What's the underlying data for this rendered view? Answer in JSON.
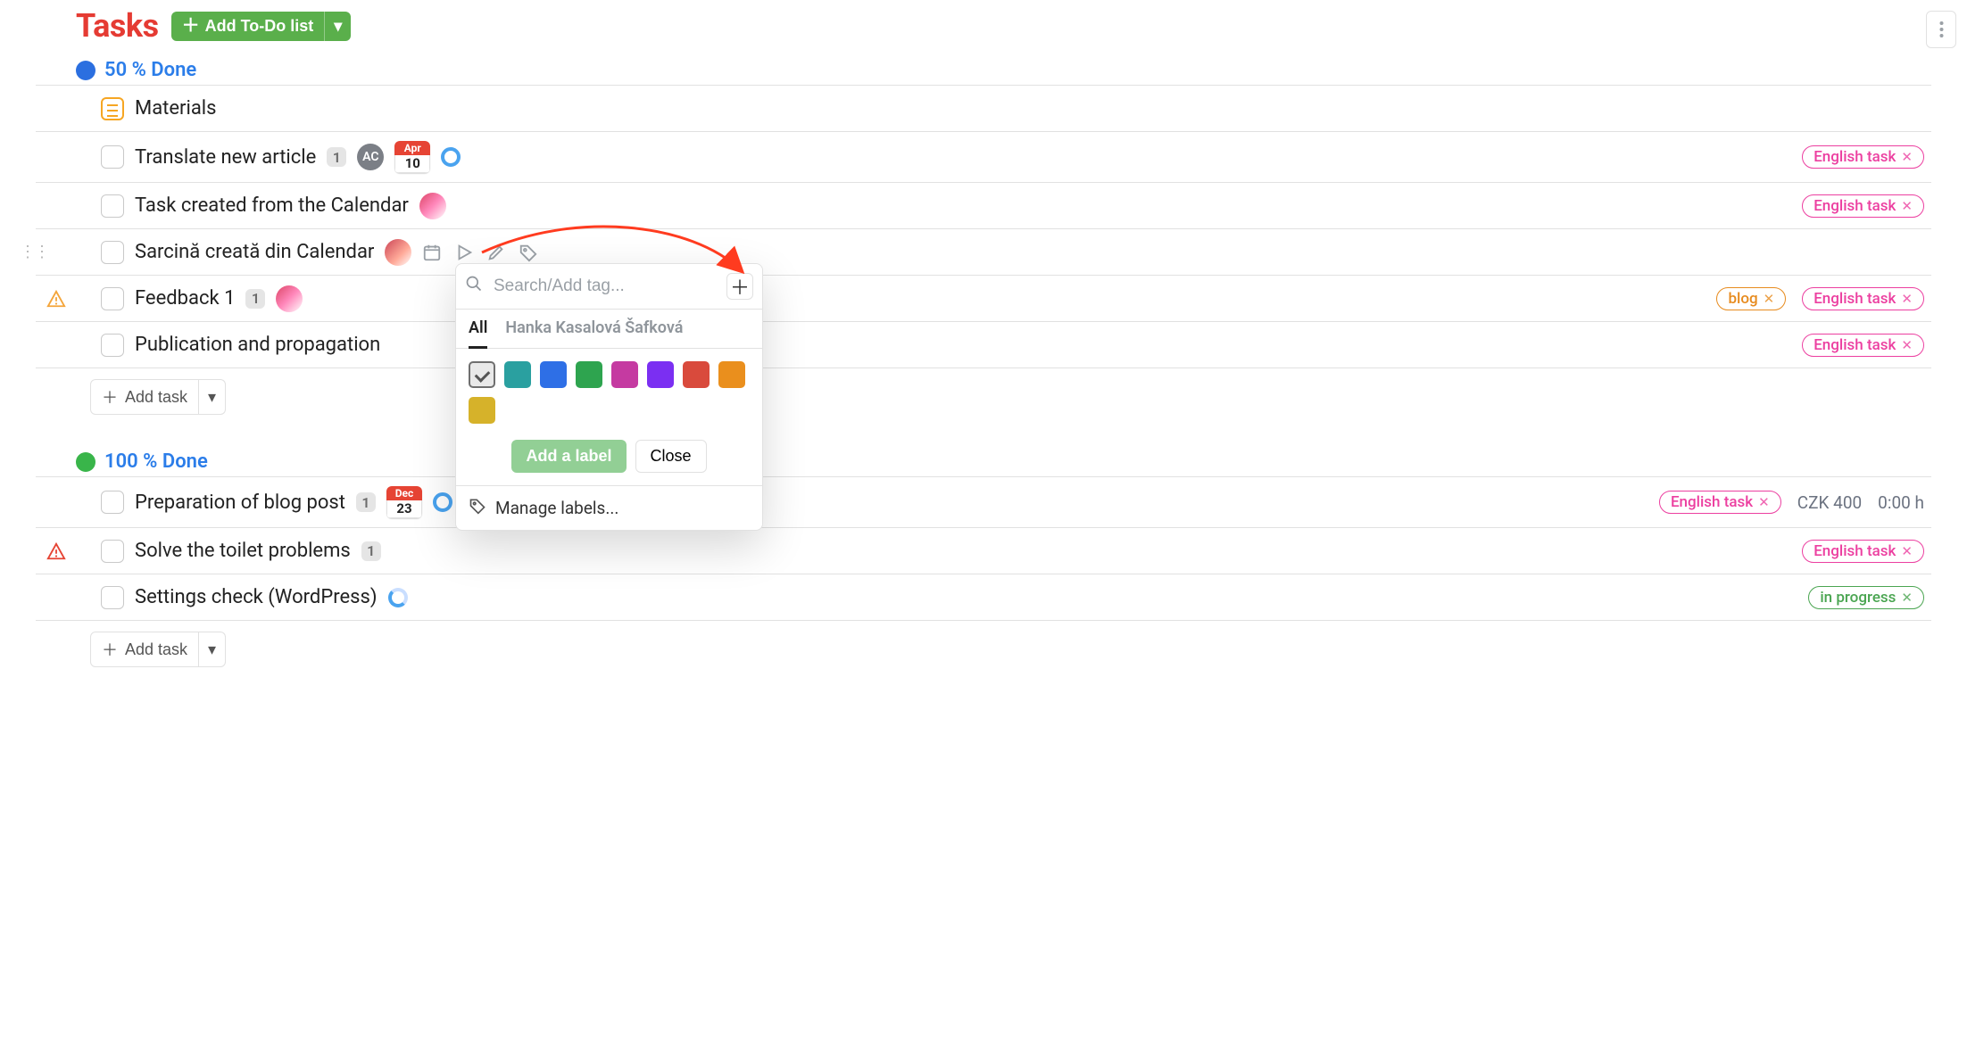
{
  "header": {
    "title": "Tasks",
    "add_button": "Add To-Do list"
  },
  "sections": [
    {
      "id": "s50",
      "dot": "blue",
      "label": "50 % Done"
    },
    {
      "id": "s100",
      "dot": "green",
      "label": "100 % Done"
    }
  ],
  "note_row": {
    "title": "Materials"
  },
  "tasks": {
    "t1": {
      "title": "Translate new article",
      "count": "1",
      "avatar_initials": "AC",
      "date_month": "Apr",
      "date_day": "10"
    },
    "t2": {
      "title": "Task created from the Calendar"
    },
    "t3": {
      "title": "Sarcină creată din Calendar"
    },
    "t4": {
      "title": "Feedback 1",
      "count": "1"
    },
    "t5": {
      "title": "Publication and propagation"
    },
    "t6": {
      "title": "Preparation of blog post",
      "count": "1",
      "date_month": "Dec",
      "date_day": "23",
      "cost": "CZK 400",
      "time": "0:00 h"
    },
    "t7": {
      "title": "Solve the toilet problems",
      "count": "1"
    },
    "t8": {
      "title": "Settings check (WordPress)"
    }
  },
  "labels": {
    "english": "English task",
    "blog": "blog",
    "in_progress": "in progress"
  },
  "add_task_label": "Add task",
  "popover": {
    "placeholder": "Search/Add tag...",
    "tab_all": "All",
    "tab_user": "Hanka Kasalová Šafková",
    "add_label": "Add a label",
    "close": "Close",
    "manage": "Manage labels...",
    "colors": [
      "#2aa0a0",
      "#2e6fe6",
      "#2ea44f",
      "#c53aa1",
      "#7b2ff2",
      "#d94a3c",
      "#ea8f1d",
      "#d6b22a"
    ]
  }
}
